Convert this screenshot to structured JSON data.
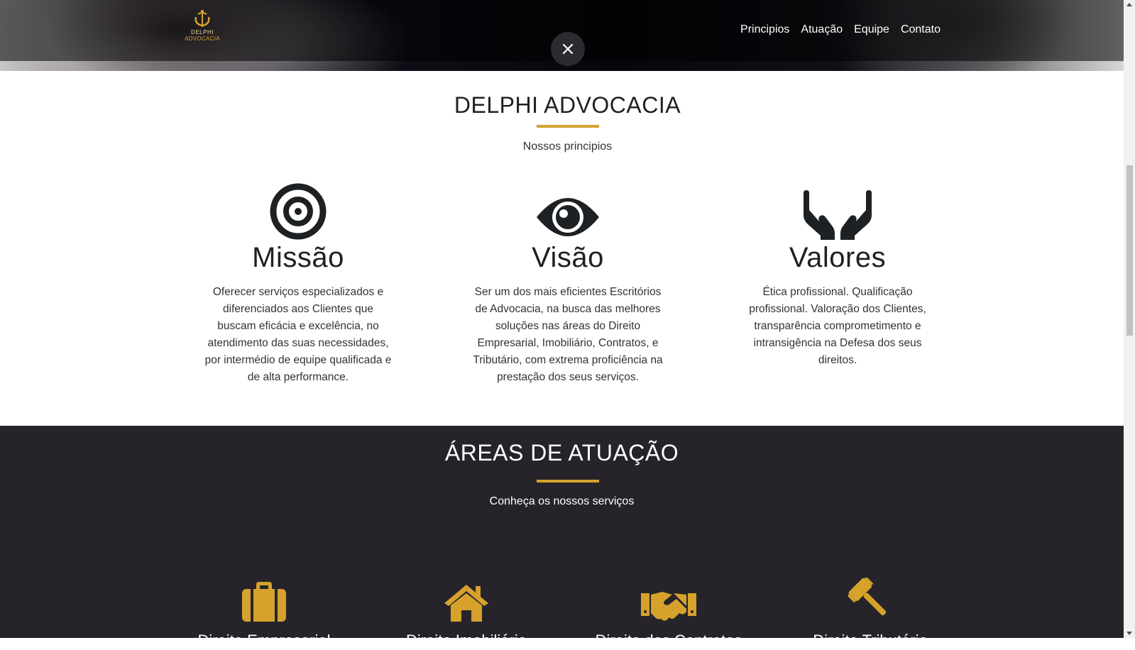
{
  "header": {
    "logo_line1": "DELPHI",
    "logo_line2": "ADVOCACIA",
    "nav": [
      "Principios",
      "Atuação",
      "Equipe",
      "Contato"
    ],
    "close_icon": "close-icon"
  },
  "principles": {
    "title": "DELPHI ADVOCACIA",
    "subtitle": "Nossos principios",
    "items": [
      {
        "icon": "target-icon",
        "title": "Missão",
        "text": "Oferecer serviços especializados e diferenciados aos Clientes que buscam eficácia e excelência, no atendimento das suas necessidades, por intermédio de equipe qualificada e de alta performance."
      },
      {
        "icon": "eye-icon",
        "title": "Visão",
        "text": "Ser um dos mais eficientes Escritórios de Advocacia, na busca das melhores soluções nas áreas do Direito Empresarial, Imobiliário, Contratos, e Tributário, com extrema proficiência na prestação dos seus serviços."
      },
      {
        "icon": "hands-icon",
        "title": "Valores",
        "text": "Ética profissional. Qualificação profissional. Valoração dos Clientes, transparência comprometimento e intransigência na Defesa dos seus direitos."
      }
    ]
  },
  "areas": {
    "title": "ÁREAS DE ATUAÇÃO",
    "subtitle": "Conheça os nossos serviços",
    "items": [
      {
        "icon": "briefcase-icon",
        "title": "Direito Empresarial"
      },
      {
        "icon": "home-icon",
        "title": "Direito Imobiliário"
      },
      {
        "icon": "handshake-icon",
        "title": "Direito dos Contratos"
      },
      {
        "icon": "gavel-icon",
        "title": "Direito Tributário"
      }
    ]
  },
  "colors": {
    "accent": "#d6a22c",
    "dark": "#26242a"
  }
}
